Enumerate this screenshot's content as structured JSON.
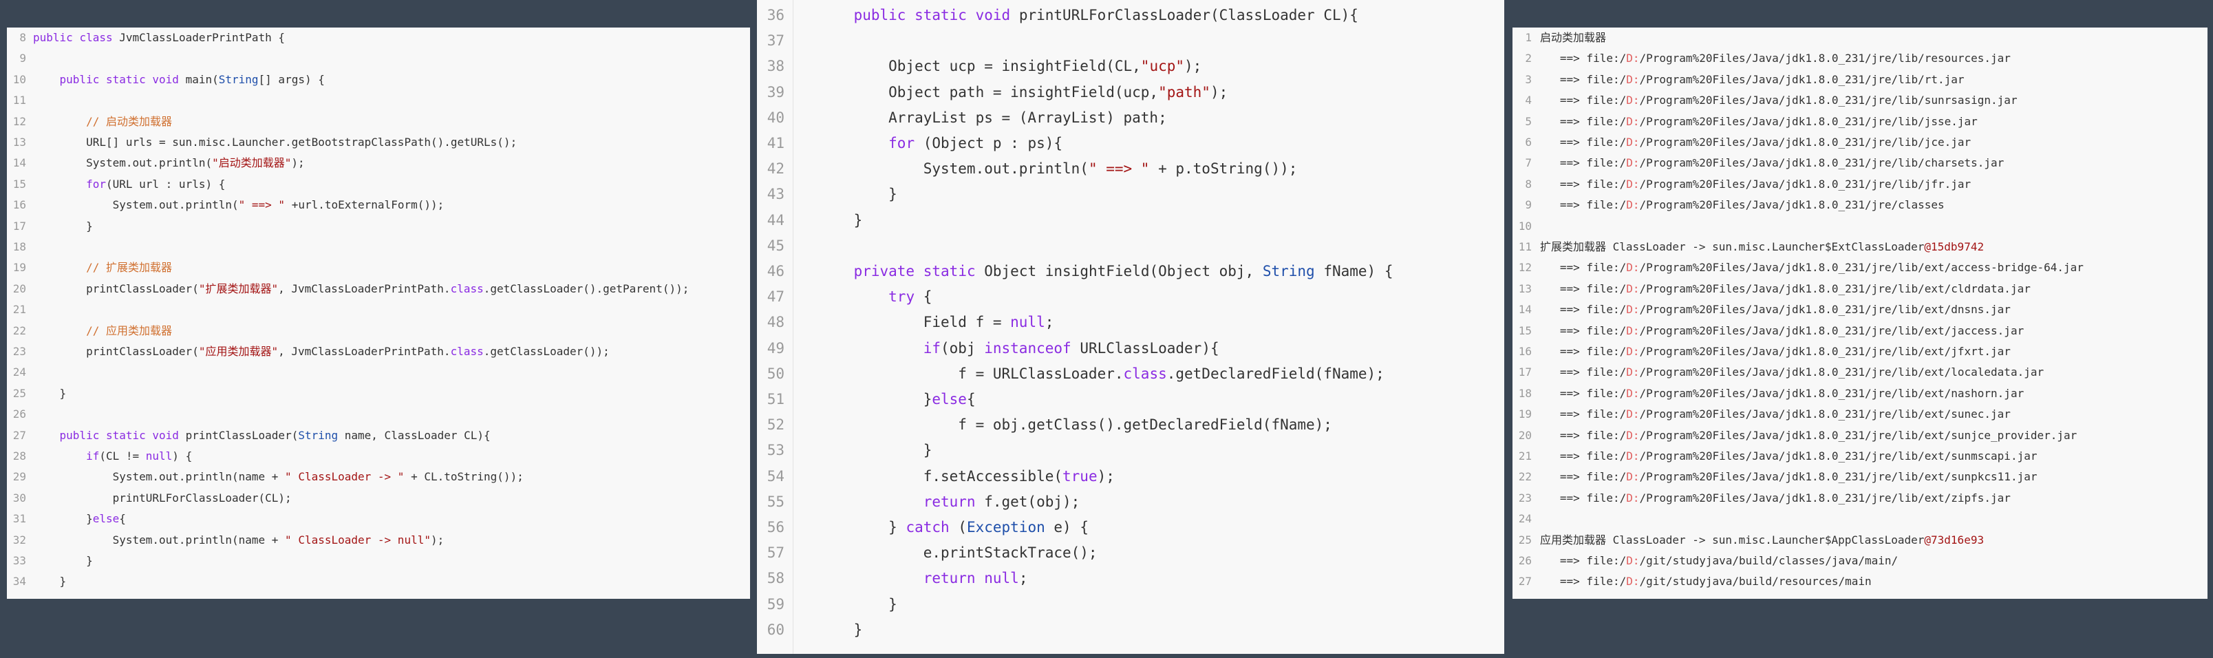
{
  "left_panel": {
    "lines": [
      {
        "n": "8",
        "t": "public class JvmClassLoaderPrintPath {"
      },
      {
        "n": "9",
        "t": ""
      },
      {
        "n": "10",
        "t": "    public static void main(String[] args) {"
      },
      {
        "n": "11",
        "t": ""
      },
      {
        "n": "12",
        "t": "        // 启动类加载器"
      },
      {
        "n": "13",
        "t": "        URL[] urls = sun.misc.Launcher.getBootstrapClassPath().getURLs();"
      },
      {
        "n": "14",
        "t": "        System.out.println(\"启动类加载器\");"
      },
      {
        "n": "15",
        "t": "        for(URL url : urls) {"
      },
      {
        "n": "16",
        "t": "            System.out.println(\" ==> \" +url.toExternalForm());"
      },
      {
        "n": "17",
        "t": "        }"
      },
      {
        "n": "18",
        "t": ""
      },
      {
        "n": "19",
        "t": "        // 扩展类加载器"
      },
      {
        "n": "20",
        "t": "        printClassLoader(\"扩展类加载器\", JvmClassLoaderPrintPath.class.getClassLoader().getParent());"
      },
      {
        "n": "21",
        "t": ""
      },
      {
        "n": "22",
        "t": "        // 应用类加载器"
      },
      {
        "n": "23",
        "t": "        printClassLoader(\"应用类加载器\", JvmClassLoaderPrintPath.class.getClassLoader());"
      },
      {
        "n": "24",
        "t": ""
      },
      {
        "n": "25",
        "t": "    }"
      },
      {
        "n": "26",
        "t": ""
      },
      {
        "n": "27",
        "t": "    public static void printClassLoader(String name, ClassLoader CL){"
      },
      {
        "n": "28",
        "t": "        if(CL != null) {"
      },
      {
        "n": "29",
        "t": "            System.out.println(name + \" ClassLoader -> \" + CL.toString());"
      },
      {
        "n": "30",
        "t": "            printURLForClassLoader(CL);"
      },
      {
        "n": "31",
        "t": "        }else{"
      },
      {
        "n": "32",
        "t": "            System.out.println(name + \" ClassLoader -> null\");"
      },
      {
        "n": "33",
        "t": "        }"
      },
      {
        "n": "34",
        "t": "    }"
      }
    ]
  },
  "middle_panel": {
    "lines": [
      {
        "n": "36",
        "t": "    public static void printURLForClassLoader(ClassLoader CL){"
      },
      {
        "n": "37",
        "t": ""
      },
      {
        "n": "38",
        "t": "        Object ucp = insightField(CL,\"ucp\");"
      },
      {
        "n": "39",
        "t": "        Object path = insightField(ucp,\"path\");"
      },
      {
        "n": "40",
        "t": "        ArrayList ps = (ArrayList) path;"
      },
      {
        "n": "41",
        "t": "        for (Object p : ps){"
      },
      {
        "n": "42",
        "t": "            System.out.println(\" ==> \" + p.toString());"
      },
      {
        "n": "43",
        "t": "        }"
      },
      {
        "n": "44",
        "t": "    }"
      },
      {
        "n": "45",
        "t": ""
      },
      {
        "n": "46",
        "t": "    private static Object insightField(Object obj, String fName) {"
      },
      {
        "n": "47",
        "t": "        try {"
      },
      {
        "n": "48",
        "t": "            Field f = null;"
      },
      {
        "n": "49",
        "t": "            if(obj instanceof URLClassLoader){"
      },
      {
        "n": "50",
        "t": "                f = URLClassLoader.class.getDeclaredField(fName);"
      },
      {
        "n": "51",
        "t": "            }else{"
      },
      {
        "n": "52",
        "t": "                f = obj.getClass().getDeclaredField(fName);"
      },
      {
        "n": "53",
        "t": "            }"
      },
      {
        "n": "54",
        "t": "            f.setAccessible(true);"
      },
      {
        "n": "55",
        "t": "            return f.get(obj);"
      },
      {
        "n": "56",
        "t": "        } catch (Exception e) {"
      },
      {
        "n": "57",
        "t": "            e.printStackTrace();"
      },
      {
        "n": "58",
        "t": "            return null;"
      },
      {
        "n": "59",
        "t": "        }"
      },
      {
        "n": "60",
        "t": "    }"
      }
    ]
  },
  "right_panel": {
    "lines": [
      {
        "n": "1",
        "t": "启动类加载器"
      },
      {
        "n": "2",
        "t": "   ==> file:/D:/Program%20Files/Java/jdk1.8.0_231/jre/lib/resources.jar"
      },
      {
        "n": "3",
        "t": "   ==> file:/D:/Program%20Files/Java/jdk1.8.0_231/jre/lib/rt.jar"
      },
      {
        "n": "4",
        "t": "   ==> file:/D:/Program%20Files/Java/jdk1.8.0_231/jre/lib/sunrsasign.jar"
      },
      {
        "n": "5",
        "t": "   ==> file:/D:/Program%20Files/Java/jdk1.8.0_231/jre/lib/jsse.jar"
      },
      {
        "n": "6",
        "t": "   ==> file:/D:/Program%20Files/Java/jdk1.8.0_231/jre/lib/jce.jar"
      },
      {
        "n": "7",
        "t": "   ==> file:/D:/Program%20Files/Java/jdk1.8.0_231/jre/lib/charsets.jar"
      },
      {
        "n": "8",
        "t": "   ==> file:/D:/Program%20Files/Java/jdk1.8.0_231/jre/lib/jfr.jar"
      },
      {
        "n": "9",
        "t": "   ==> file:/D:/Program%20Files/Java/jdk1.8.0_231/jre/classes"
      },
      {
        "n": "10",
        "t": ""
      },
      {
        "n": "11",
        "t": "扩展类加载器 ClassLoader -> sun.misc.Launcher$ExtClassLoader@15db9742"
      },
      {
        "n": "12",
        "t": "   ==> file:/D:/Program%20Files/Java/jdk1.8.0_231/jre/lib/ext/access-bridge-64.jar"
      },
      {
        "n": "13",
        "t": "   ==> file:/D:/Program%20Files/Java/jdk1.8.0_231/jre/lib/ext/cldrdata.jar"
      },
      {
        "n": "14",
        "t": "   ==> file:/D:/Program%20Files/Java/jdk1.8.0_231/jre/lib/ext/dnsns.jar"
      },
      {
        "n": "15",
        "t": "   ==> file:/D:/Program%20Files/Java/jdk1.8.0_231/jre/lib/ext/jaccess.jar"
      },
      {
        "n": "16",
        "t": "   ==> file:/D:/Program%20Files/Java/jdk1.8.0_231/jre/lib/ext/jfxrt.jar"
      },
      {
        "n": "17",
        "t": "   ==> file:/D:/Program%20Files/Java/jdk1.8.0_231/jre/lib/ext/localedata.jar"
      },
      {
        "n": "18",
        "t": "   ==> file:/D:/Program%20Files/Java/jdk1.8.0_231/jre/lib/ext/nashorn.jar"
      },
      {
        "n": "19",
        "t": "   ==> file:/D:/Program%20Files/Java/jdk1.8.0_231/jre/lib/ext/sunec.jar"
      },
      {
        "n": "20",
        "t": "   ==> file:/D:/Program%20Files/Java/jdk1.8.0_231/jre/lib/ext/sunjce_provider.jar"
      },
      {
        "n": "21",
        "t": "   ==> file:/D:/Program%20Files/Java/jdk1.8.0_231/jre/lib/ext/sunmscapi.jar"
      },
      {
        "n": "22",
        "t": "   ==> file:/D:/Program%20Files/Java/jdk1.8.0_231/jre/lib/ext/sunpkcs11.jar"
      },
      {
        "n": "23",
        "t": "   ==> file:/D:/Program%20Files/Java/jdk1.8.0_231/jre/lib/ext/zipfs.jar"
      },
      {
        "n": "24",
        "t": ""
      },
      {
        "n": "25",
        "t": "应用类加载器 ClassLoader -> sun.misc.Launcher$AppClassLoader@73d16e93"
      },
      {
        "n": "26",
        "t": "   ==> file:/D:/git/studyjava/build/classes/java/main/"
      },
      {
        "n": "27",
        "t": "   ==> file:/D:/git/studyjava/build/resources/main"
      }
    ]
  },
  "colors": {
    "background": "#3a4654",
    "panel": "#f8f8f8",
    "text": "#333333",
    "line_number": "#9a9a9a",
    "keyword": "#8a2be2",
    "string": "#a31515",
    "type": "#1f4faa",
    "comment": "#d07030",
    "drive": "#e06060"
  }
}
